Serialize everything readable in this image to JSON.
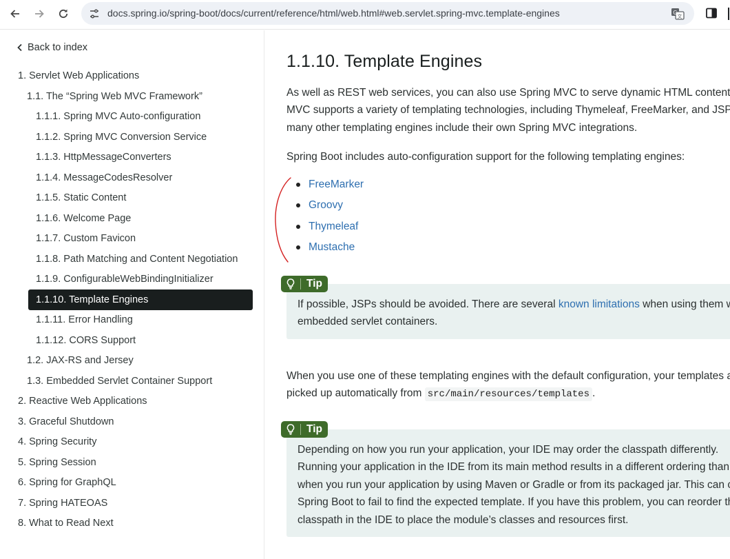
{
  "browser": {
    "url": "docs.spring.io/spring-boot/docs/current/reference/html/web.html#web.servlet.spring-mvc.template-engines",
    "icons": [
      "back-arrow-icon",
      "forward-arrow-icon",
      "reload-icon",
      "site-info-icon",
      "translate-icon",
      "side-panel-icon"
    ]
  },
  "sidebar": {
    "back_label": "Back to index",
    "items": [
      {
        "label": "1. Servlet Web Applications"
      },
      {
        "label": "1.1. The “Spring Web MVC Framework”"
      },
      {
        "label": "1.1.1. Spring MVC Auto-configuration"
      },
      {
        "label": "1.1.2. Spring MVC Conversion Service"
      },
      {
        "label": "1.1.3. HttpMessageConverters"
      },
      {
        "label": "1.1.4. MessageCodesResolver"
      },
      {
        "label": "1.1.5. Static Content"
      },
      {
        "label": "1.1.6. Welcome Page"
      },
      {
        "label": "1.1.7. Custom Favicon"
      },
      {
        "label": "1.1.8. Path Matching and Content Negotiation"
      },
      {
        "label": "1.1.9. ConfigurableWebBindingInitializer"
      },
      {
        "label": "1.1.10. Template Engines"
      },
      {
        "label": "1.1.11. Error Handling"
      },
      {
        "label": "1.1.12. CORS Support"
      },
      {
        "label": "1.2. JAX-RS and Jersey"
      },
      {
        "label": "1.3. Embedded Servlet Container Support"
      },
      {
        "label": "2. Reactive Web Applications"
      },
      {
        "label": "3. Graceful Shutdown"
      },
      {
        "label": "4. Spring Security"
      },
      {
        "label": "5. Spring Session"
      },
      {
        "label": "6. Spring for GraphQL"
      },
      {
        "label": "7. Spring HATEOAS"
      },
      {
        "label": "8. What to Read Next"
      }
    ]
  },
  "main": {
    "title": "1.1.10. Template Engines",
    "intro_lines": [
      "As well as REST web services, you can also use Spring MVC to serve dynamic HTML content. Spring",
      "MVC supports a variety of templating technologies, including Thymeleaf, FreeMarker, and JSPs. Also,",
      "many other templating engines include their own Spring MVC integrations."
    ],
    "support_line": "Spring Boot includes auto-configuration support for the following templating engines:",
    "engines": [
      "FreeMarker",
      "Groovy",
      "Thymeleaf",
      "Mustache"
    ],
    "tip1": {
      "label": "Tip",
      "line1_before": "If possible, JSPs should be avoided. There are several ",
      "line1_link": "known limitations",
      "line1_after": " when using them with",
      "line2": "embedded servlet containers."
    },
    "default_config": {
      "line1": "When you use one of these templating engines with the default configuration, your templates are",
      "line2_before": "picked up automatically from ",
      "line2_code": "src/main/resources/templates",
      "line2_after": "."
    },
    "tip2": {
      "label": "Tip",
      "lines": [
        "Depending on how you run your application, your IDE may order the classpath differently.",
        "Running your application in the IDE from its main method results in a different ordering than",
        "when you run your application by using Maven or Gradle or from its packaged jar. This can cause",
        "Spring Boot to fail to find the expected template. If you have this problem, you can reorder the",
        "classpath in the IDE to place the module’s classes and resources first."
      ]
    }
  },
  "colors": {
    "active_bg": "#191e1e",
    "link": "#2e6fb0",
    "tip_badge": "#3e6b2a",
    "tip_bg": "#e9f1f0",
    "annotation": "#d42020"
  }
}
